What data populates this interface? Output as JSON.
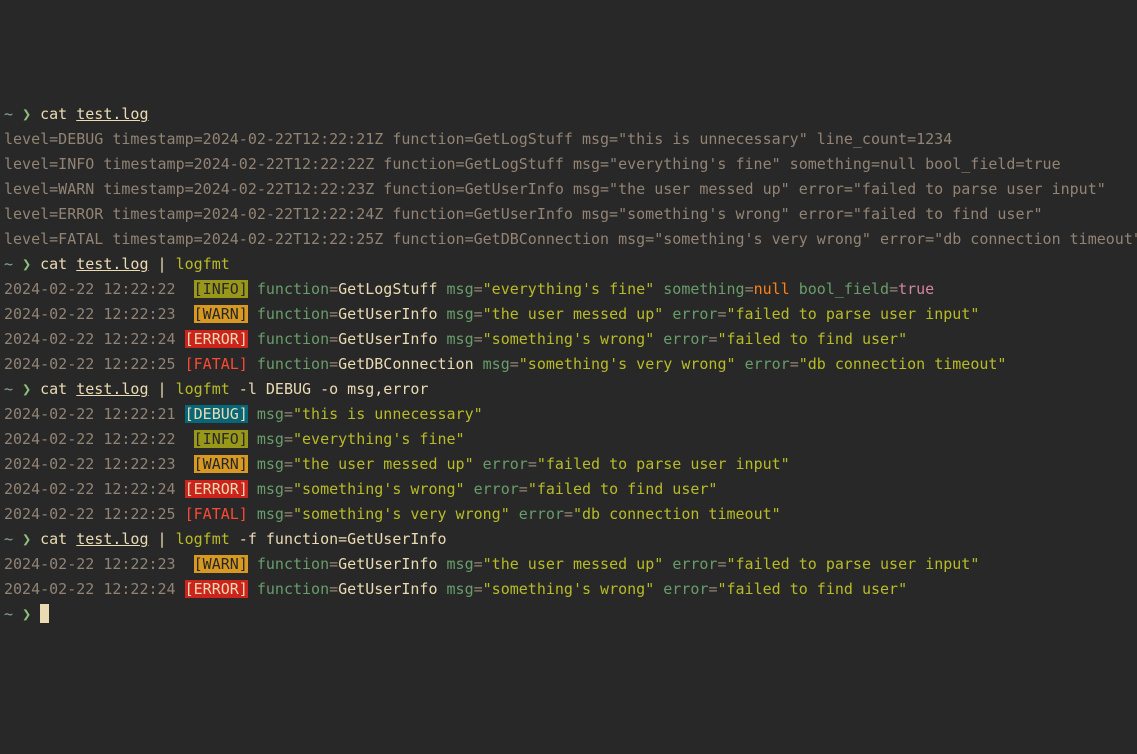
{
  "prompt": {
    "home": "~",
    "arrow": "❯"
  },
  "cmd": {
    "cat": "cat",
    "file": "test.log",
    "pipe": "|",
    "logfmt": "logfmt",
    "flags2": "-l DEBUG -o msg,error",
    "flags3": "-f function=GetUserInfo"
  },
  "levels": {
    "debug": "[DEBUG]",
    "info": "[INFO]",
    "warn": "[WARN]",
    "error": "[ERROR]",
    "fatal": "[FATAL]"
  },
  "raw": [
    "level=DEBUG timestamp=2024-02-22T12:22:21Z function=GetLogStuff msg=\"this is unnecessary\" line_count=1234",
    "level=INFO timestamp=2024-02-22T12:22:22Z function=GetLogStuff msg=\"everything's fine\" something=null bool_field=true",
    "level=WARN timestamp=2024-02-22T12:22:23Z function=GetUserInfo msg=\"the user messed up\" error=\"failed to parse user input\"",
    "level=ERROR timestamp=2024-02-22T12:22:24Z function=GetUserInfo msg=\"something's wrong\" error=\"failed to find user\"",
    "level=FATAL timestamp=2024-02-22T12:22:25Z function=GetDBConnection msg=\"something's very wrong\" error=\"db connection timeout\""
  ],
  "block1": [
    {
      "ts": "2024-02-22 12:22:22",
      "pad": "  ",
      "level": "info",
      "fields": [
        {
          "k": "function",
          "v": "GetLogStuff",
          "t": "val"
        },
        {
          "k": "msg",
          "v": "\"everything's fine\"",
          "t": "str"
        },
        {
          "k": "something",
          "v": "null",
          "t": "nullv"
        },
        {
          "k": "bool_field",
          "v": "true",
          "t": "boolv"
        }
      ]
    },
    {
      "ts": "2024-02-22 12:22:23",
      "pad": "  ",
      "level": "warn",
      "fields": [
        {
          "k": "function",
          "v": "GetUserInfo",
          "t": "val"
        },
        {
          "k": "msg",
          "v": "\"the user messed up\"",
          "t": "str"
        },
        {
          "k": "error",
          "v": "\"failed to parse user input\"",
          "t": "str"
        }
      ]
    },
    {
      "ts": "2024-02-22 12:22:24",
      "pad": " ",
      "level": "error",
      "fields": [
        {
          "k": "function",
          "v": "GetUserInfo",
          "t": "val"
        },
        {
          "k": "msg",
          "v": "\"something's wrong\"",
          "t": "str"
        },
        {
          "k": "error",
          "v": "\"failed to find user\"",
          "t": "str"
        }
      ]
    },
    {
      "ts": "2024-02-22 12:22:25",
      "pad": " ",
      "level": "fatal",
      "fields": [
        {
          "k": "function",
          "v": "GetDBConnection",
          "t": "val"
        },
        {
          "k": "msg",
          "v": "\"something's very wrong\"",
          "t": "str"
        },
        {
          "k": "error",
          "v": "\"db connection timeout\"",
          "t": "str"
        }
      ]
    }
  ],
  "block2": [
    {
      "ts": "2024-02-22 12:22:21",
      "pad": " ",
      "level": "debug",
      "fields": [
        {
          "k": "msg",
          "v": "\"this is unnecessary\"",
          "t": "str"
        }
      ]
    },
    {
      "ts": "2024-02-22 12:22:22",
      "pad": "  ",
      "level": "info",
      "fields": [
        {
          "k": "msg",
          "v": "\"everything's fine\"",
          "t": "str"
        }
      ]
    },
    {
      "ts": "2024-02-22 12:22:23",
      "pad": "  ",
      "level": "warn",
      "fields": [
        {
          "k": "msg",
          "v": "\"the user messed up\"",
          "t": "str"
        },
        {
          "k": "error",
          "v": "\"failed to parse user input\"",
          "t": "str"
        }
      ]
    },
    {
      "ts": "2024-02-22 12:22:24",
      "pad": " ",
      "level": "error",
      "fields": [
        {
          "k": "msg",
          "v": "\"something's wrong\"",
          "t": "str"
        },
        {
          "k": "error",
          "v": "\"failed to find user\"",
          "t": "str"
        }
      ]
    },
    {
      "ts": "2024-02-22 12:22:25",
      "pad": " ",
      "level": "fatal",
      "fields": [
        {
          "k": "msg",
          "v": "\"something's very wrong\"",
          "t": "str"
        },
        {
          "k": "error",
          "v": "\"db connection timeout\"",
          "t": "str"
        }
      ]
    }
  ],
  "block3": [
    {
      "ts": "2024-02-22 12:22:23",
      "pad": "  ",
      "level": "warn",
      "fields": [
        {
          "k": "function",
          "v": "GetUserInfo",
          "t": "val"
        },
        {
          "k": "msg",
          "v": "\"the user messed up\"",
          "t": "str"
        },
        {
          "k": "error",
          "v": "\"failed to parse user input\"",
          "t": "str"
        }
      ]
    },
    {
      "ts": "2024-02-22 12:22:24",
      "pad": " ",
      "level": "error",
      "fields": [
        {
          "k": "function",
          "v": "GetUserInfo",
          "t": "val"
        },
        {
          "k": "msg",
          "v": "\"something's wrong\"",
          "t": "str"
        },
        {
          "k": "error",
          "v": "\"failed to find user\"",
          "t": "str"
        }
      ]
    }
  ]
}
